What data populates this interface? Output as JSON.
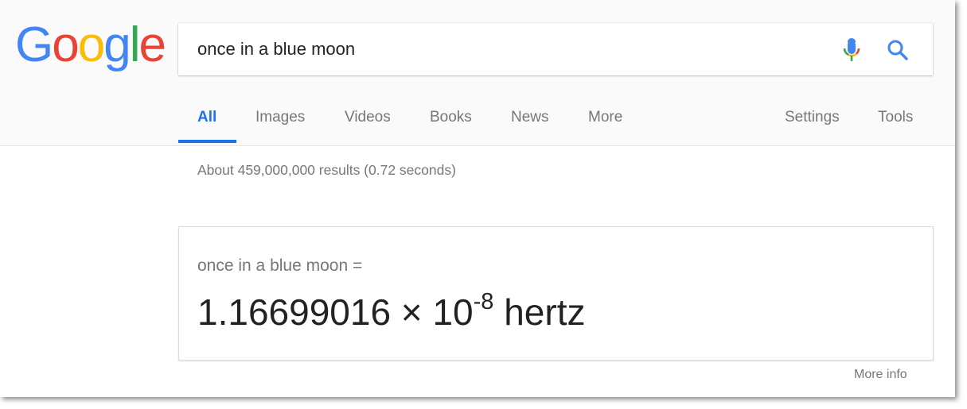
{
  "logo": {
    "letters": [
      "G",
      "o",
      "o",
      "g",
      "l",
      "e"
    ],
    "colors": [
      "#4285F4",
      "#EA4335",
      "#FBBC05",
      "#4285F4",
      "#34A853",
      "#EA4335"
    ]
  },
  "search": {
    "value": "once in a blue moon",
    "mic_icon": "microphone-icon",
    "search_icon": "magnifier-icon"
  },
  "tabs": {
    "all": "All",
    "images": "Images",
    "videos": "Videos",
    "books": "Books",
    "news": "News",
    "more": "More",
    "settings": "Settings",
    "tools": "Tools",
    "active": "All"
  },
  "results_stats": "About 459,000,000 results (0.72 seconds)",
  "answer_card": {
    "query": "once in a blue moon =",
    "mantissa": "1.16699016 × 10",
    "exponent": "-8",
    "unit": "hertz"
  },
  "more_info": "More info",
  "colors": {
    "accent": "#1a73e8",
    "muted_text": "#777777",
    "body_text": "#222222"
  }
}
